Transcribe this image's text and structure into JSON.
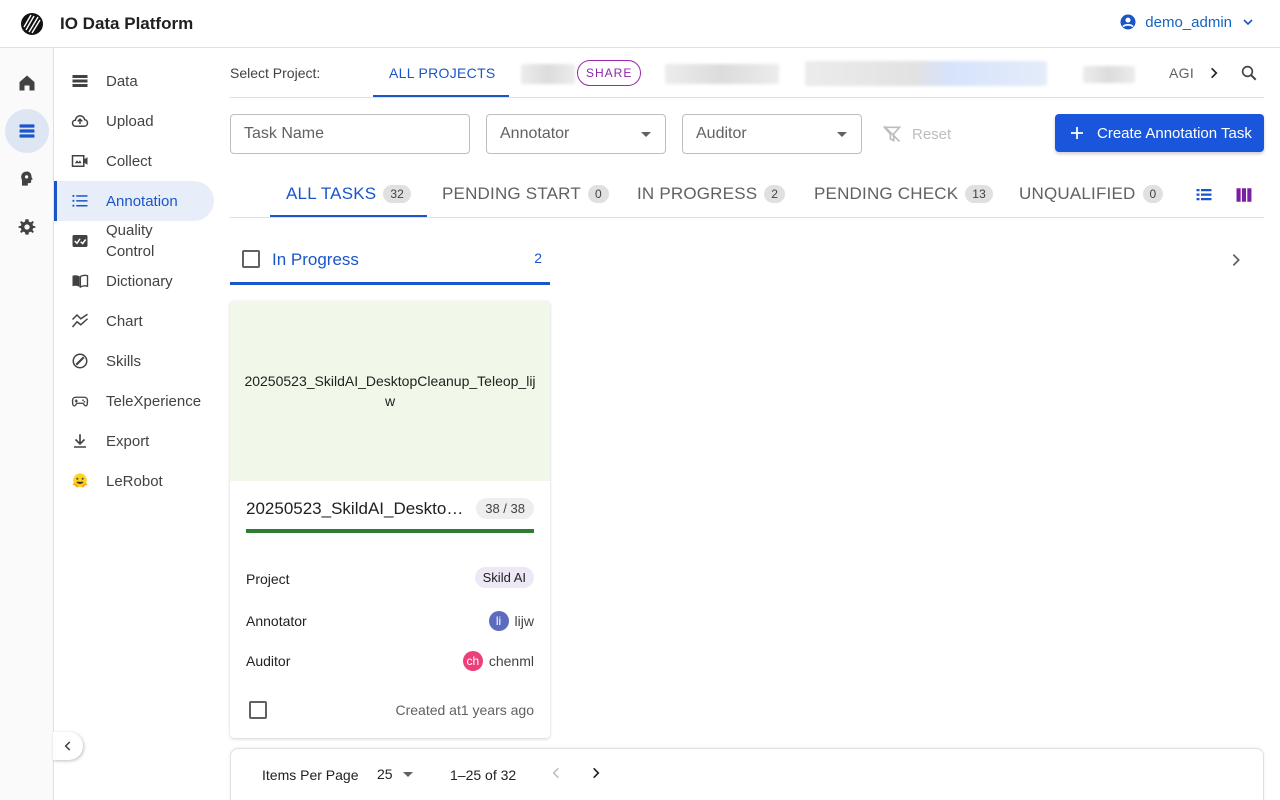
{
  "app": {
    "title": "IO Data Platform",
    "user": "demo_admin"
  },
  "rail": {
    "items": [
      "home-icon",
      "dataset-icon",
      "brain-icon",
      "settings-icon"
    ],
    "active": 1
  },
  "sidebar": {
    "items": [
      {
        "label": "Data",
        "icon": "storage-icon"
      },
      {
        "label": "Upload",
        "icon": "cloud-upload-icon"
      },
      {
        "label": "Collect",
        "icon": "video-collect-icon"
      },
      {
        "label": "Annotation",
        "icon": "list-icon"
      },
      {
        "label": "Quality\nControl",
        "icon": "checklist-icon"
      },
      {
        "label": "Dictionary",
        "icon": "book-icon"
      },
      {
        "label": "Chart",
        "icon": "chart-icon"
      },
      {
        "label": "Skills",
        "icon": "skills-icon"
      },
      {
        "label": "TeleXperience",
        "icon": "gamepad-icon"
      },
      {
        "label": "Export",
        "icon": "download-icon"
      },
      {
        "label": "LeRobot",
        "icon": "hugging-face-icon"
      }
    ],
    "active": "Annotation"
  },
  "projects": {
    "label": "Select Project:",
    "all": "ALL PROJECTS",
    "share_chip": "SHARE",
    "trailing_tab": "AGI"
  },
  "filters": {
    "task_name_placeholder": "Task Name",
    "annotator": "Annotator",
    "auditor": "Auditor",
    "reset": "Reset",
    "create_button": "Create Annotation Task"
  },
  "status_tabs": [
    {
      "label": "ALL TASKS",
      "count": "32"
    },
    {
      "label": "PENDING START",
      "count": "0"
    },
    {
      "label": "IN PROGRESS",
      "count": "2"
    },
    {
      "label": "PENDING CHECK",
      "count": "13"
    },
    {
      "label": "UNQUALIFIED",
      "count": "0"
    }
  ],
  "column": {
    "title": "In Progress",
    "count": "2"
  },
  "card": {
    "thumb_text": "20250523_SkildAI_DesktopCleanup_Teleop_lijw",
    "title": "20250523_SkildAI_DesktopCleanup_Teleop_lijw",
    "progress_text": "38 / 38",
    "progress_fraction": 1.0,
    "project_label": "Project",
    "project_value": "Skild AI",
    "annotator_label": "Annotator",
    "annotator_initials": "li",
    "annotator_name": "lijw",
    "annotator_color": "#5c6bc0",
    "auditor_label": "Auditor",
    "auditor_initials": "ch",
    "auditor_name": "chenml",
    "auditor_color": "#ec407a",
    "created": "Created at1 years ago"
  },
  "pagination": {
    "label": "Items Per Page",
    "per_page": "25",
    "range": "1–25 of 32"
  },
  "colors": {
    "primary": "#1a56db",
    "progress": "#2e7d32"
  }
}
